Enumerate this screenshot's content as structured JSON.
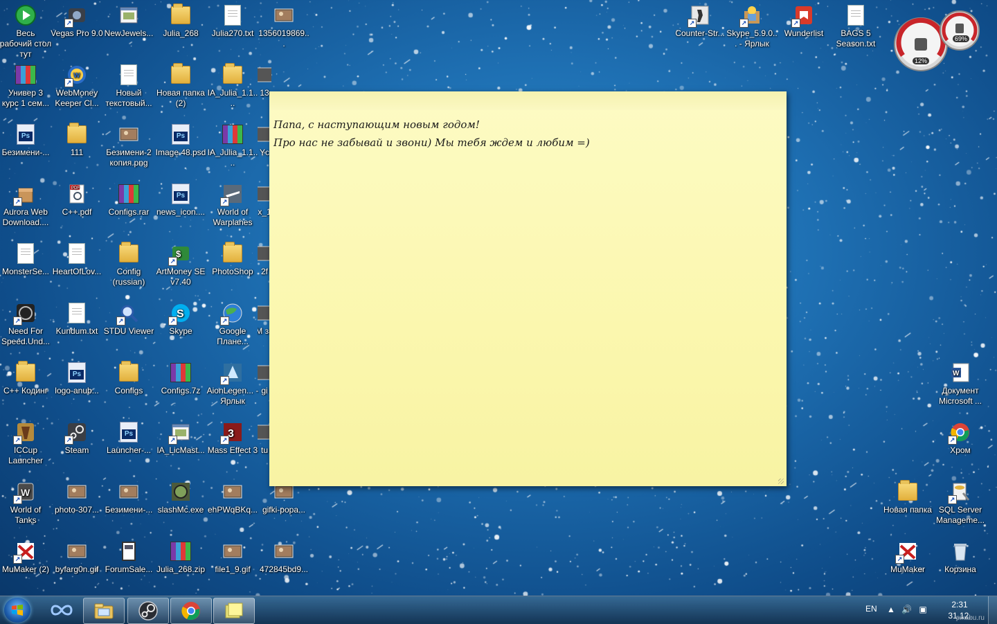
{
  "desktop": {
    "icons": [
      {
        "label": "Весь рабочий стол тут",
        "kind": "app-green-play",
        "shortcut": false
      },
      {
        "label": "Vegas Pro 9.0",
        "kind": "app-dark",
        "shortcut": true
      },
      {
        "label": "NewJewels...",
        "kind": "app-window",
        "shortcut": false
      },
      {
        "label": "Julia_268",
        "kind": "folder",
        "shortcut": false
      },
      {
        "label": "Julia270.txt",
        "kind": "doc",
        "shortcut": false
      },
      {
        "label": "1356019869...",
        "kind": "image",
        "shortcut": false
      },
      {
        "label": "Универ 3 курс 1 сем...",
        "kind": "rar",
        "shortcut": false
      },
      {
        "label": "WebMoney Keeper Cl...",
        "kind": "app-webmoney",
        "shortcut": true
      },
      {
        "label": "Новый текстовый...",
        "kind": "doc",
        "shortcut": false
      },
      {
        "label": "Новая папка (2)",
        "kind": "folder",
        "shortcut": false
      },
      {
        "label": "IA_Julia_1.1....",
        "kind": "folder",
        "shortcut": false
      },
      {
        "label": "Безимени-...",
        "kind": "psd",
        "shortcut": false
      },
      {
        "label": "111",
        "kind": "folder",
        "shortcut": false
      },
      {
        "label": "Безимени-2 копия.png",
        "kind": "image",
        "shortcut": false
      },
      {
        "label": "Image 48.psd",
        "kind": "psd",
        "shortcut": false
      },
      {
        "label": "IA_Julia_1.1....",
        "kind": "rar",
        "shortcut": false
      },
      {
        "label": "Aurora Web Download....",
        "kind": "app-box",
        "shortcut": true
      },
      {
        "label": "C++.pdf",
        "kind": "pdf",
        "shortcut": false
      },
      {
        "label": "Configs.rar",
        "kind": "rar",
        "shortcut": false
      },
      {
        "label": "news_icon....",
        "kind": "psd",
        "shortcut": false
      },
      {
        "label": "World of Warplanes",
        "kind": "app-plane",
        "shortcut": true
      },
      {
        "label": "MonsterSe...",
        "kind": "doc",
        "shortcut": false
      },
      {
        "label": "HeartOfLov...",
        "kind": "doc",
        "shortcut": false
      },
      {
        "label": "Config (russian)",
        "kind": "folder",
        "shortcut": false
      },
      {
        "label": "ArtMoney SE v7.40",
        "kind": "app-money",
        "shortcut": true
      },
      {
        "label": "PhotoShop",
        "kind": "folder",
        "shortcut": false
      },
      {
        "label": "Need For Speed.Und...",
        "kind": "app-nfs",
        "shortcut": true
      },
      {
        "label": "Kundum.txt",
        "kind": "doc",
        "shortcut": false
      },
      {
        "label": "STDU Viewer",
        "kind": "app-viewer",
        "shortcut": true
      },
      {
        "label": "Skype",
        "kind": "app-skype",
        "shortcut": true
      },
      {
        "label": "Google Плане...",
        "kind": "app-earth",
        "shortcut": true
      },
      {
        "label": "C++ Кодинг",
        "kind": "folder",
        "shortcut": false
      },
      {
        "label": "logo-anub...",
        "kind": "psd",
        "shortcut": false
      },
      {
        "label": "Configs",
        "kind": "folder",
        "shortcut": false
      },
      {
        "label": "Configs.7z",
        "kind": "rar",
        "shortcut": false
      },
      {
        "label": "AionLegen... - Ярлык",
        "kind": "app-aion",
        "shortcut": true
      },
      {
        "label": "ICCup Launcher",
        "kind": "app-iccup",
        "shortcut": true
      },
      {
        "label": "Steam",
        "kind": "app-steam",
        "shortcut": true
      },
      {
        "label": "Launcher-...",
        "kind": "psd",
        "shortcut": false
      },
      {
        "label": "IA_LicMast...",
        "kind": "app-window",
        "shortcut": true
      },
      {
        "label": "Mass Effect 3",
        "kind": "app-me3",
        "shortcut": true
      },
      {
        "label": "World of Tanks",
        "kind": "app-wot",
        "shortcut": true
      },
      {
        "label": "photo-307...",
        "kind": "image",
        "shortcut": false
      },
      {
        "label": "Безимени-...",
        "kind": "image",
        "shortcut": false
      },
      {
        "label": "slashMc.exe",
        "kind": "app-slash",
        "shortcut": false
      },
      {
        "label": "ehPWqBKq...",
        "kind": "image",
        "shortcut": false
      },
      {
        "label": "gifki-popa...",
        "kind": "image",
        "shortcut": false
      },
      {
        "label": "MuMaker (2)",
        "kind": "app-mu",
        "shortcut": true
      },
      {
        "label": "byfarg0n.gif",
        "kind": "image",
        "shortcut": false
      },
      {
        "label": "ForumSale...",
        "kind": "app-book",
        "shortcut": false
      },
      {
        "label": "Julia_268.zip",
        "kind": "rar",
        "shortcut": false
      },
      {
        "label": "file1_9.gif",
        "kind": "image",
        "shortcut": false
      },
      {
        "label": "472845bd9...",
        "kind": "image",
        "shortcut": false
      },
      {
        "label": "Counter-Str...",
        "kind": "app-cs",
        "shortcut": true
      },
      {
        "label": "Skype_5.9.0... - Ярлык",
        "kind": "app-setup",
        "shortcut": true
      },
      {
        "label": "Wunderlist",
        "kind": "app-wunder",
        "shortcut": true
      },
      {
        "label": "BAGS 5 Season.txt",
        "kind": "doc",
        "shortcut": false
      },
      {
        "label": "Документ Microsoft ...",
        "kind": "app-word",
        "shortcut": false
      },
      {
        "label": "Хром",
        "kind": "app-chrome",
        "shortcut": true
      },
      {
        "label": "Новая папка",
        "kind": "folder",
        "shortcut": false
      },
      {
        "label": "SQL Server Manageme...",
        "kind": "app-sql",
        "shortcut": true
      },
      {
        "label": "MuMaker",
        "kind": "app-mu",
        "shortcut": true
      },
      {
        "label": "Корзина",
        "kind": "app-bin",
        "shortcut": false
      },
      {
        "label": "Yc",
        "kind": "partial",
        "shortcut": false
      },
      {
        "label": "x_1",
        "kind": "partial",
        "shortcut": false
      },
      {
        "label": "2f",
        "kind": "partial",
        "shortcut": false
      },
      {
        "label": "M за",
        "kind": "partial",
        "shortcut": false
      },
      {
        "label": "gi",
        "kind": "partial",
        "shortcut": false
      },
      {
        "label": "tu",
        "kind": "partial",
        "shortcut": false
      },
      {
        "label": "13",
        "kind": "partial",
        "shortcut": false
      }
    ]
  },
  "sticky_note": {
    "line1": "Папа, с наступающим новым годом!",
    "line2": "Про нас не забывай и звони) Мы тебя ждем и любим =)"
  },
  "gadget": {
    "cpu": "12%",
    "memory": "69%"
  },
  "taskbar": {
    "buttons": [
      {
        "name": "infinity-icon"
      },
      {
        "name": "explorer-icon"
      },
      {
        "name": "steam-icon"
      },
      {
        "name": "chrome-icon"
      },
      {
        "name": "sticky-notes-icon"
      }
    ],
    "language": "EN",
    "time": "2:31",
    "date": "31.12.",
    "watermark": "pikabu.ru"
  },
  "colors": {
    "desktop_bg": "#1e6fb2",
    "sticky_bg": "#fbf7ae",
    "taskbar": "#1f4a70"
  }
}
